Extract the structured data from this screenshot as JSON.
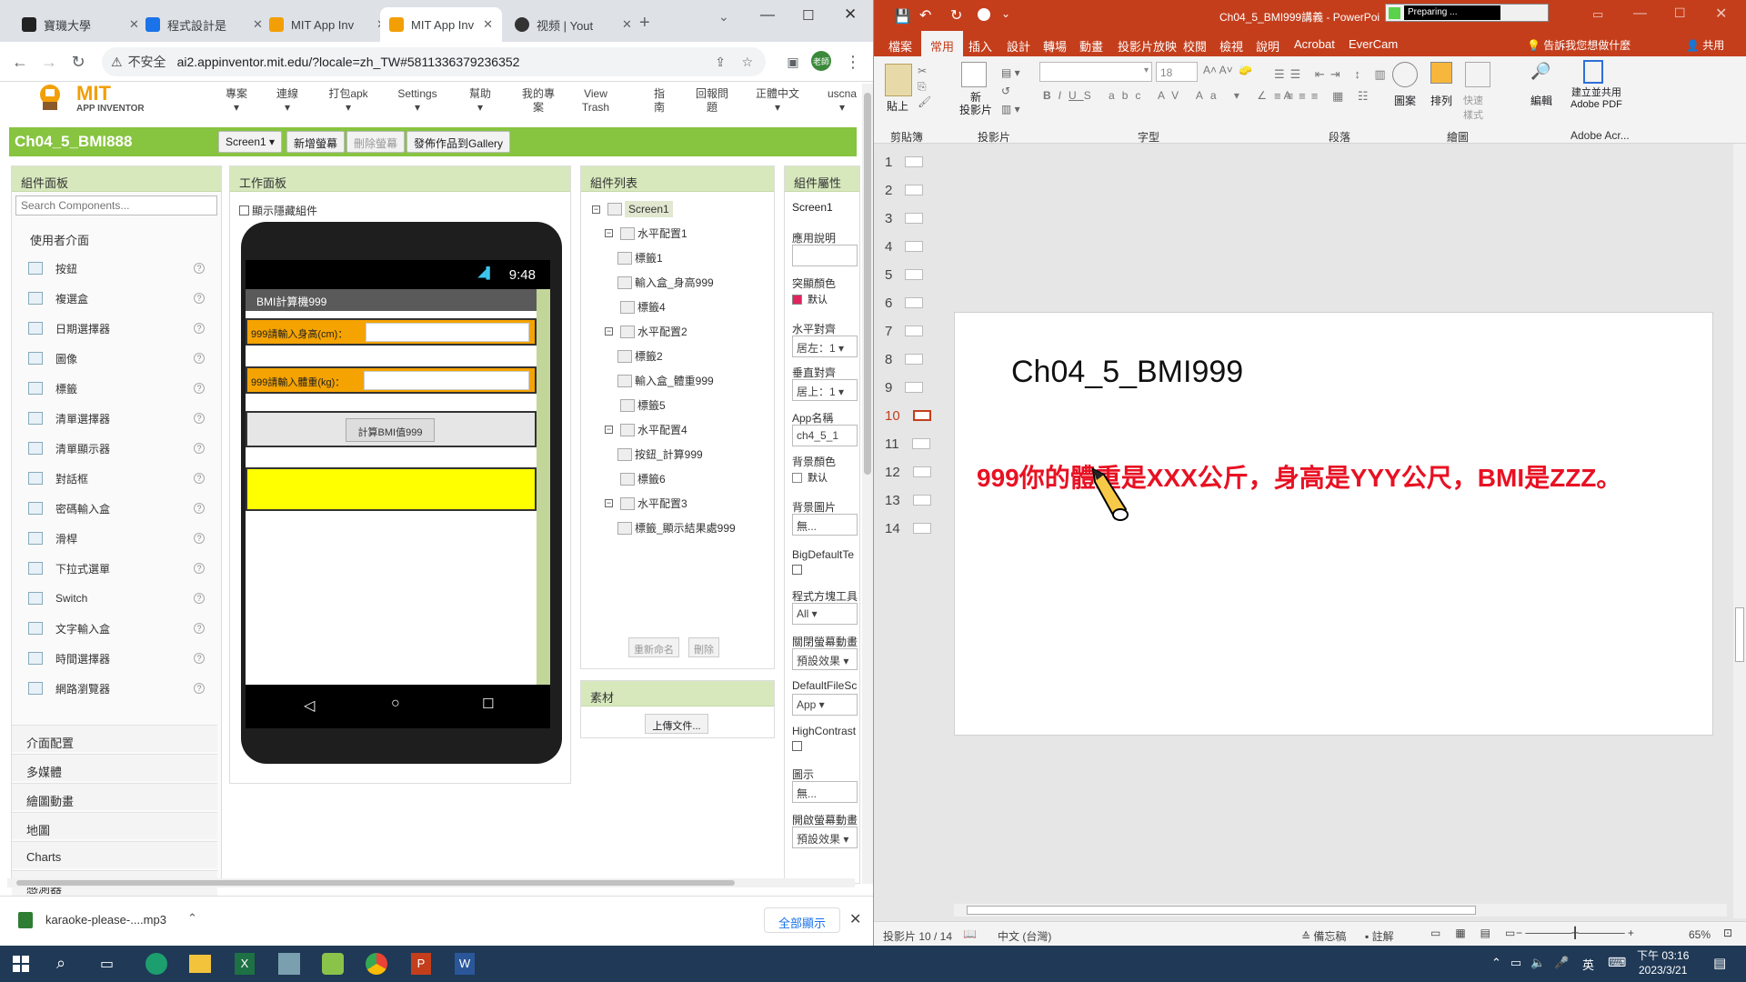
{
  "browser": {
    "tabs": [
      {
        "label": "寶璣大學",
        "icon": "github-icon",
        "color": "#222"
      },
      {
        "label": "程式設計是",
        "icon": "pen-icon",
        "color": "#1a73e8"
      },
      {
        "label": "MIT App Inv",
        "icon": "ai-icon",
        "color": "#f29f05"
      },
      {
        "label": "MIT App Inv",
        "icon": "ai-icon",
        "color": "#f29f05"
      },
      {
        "label": "视频 | Yout",
        "icon": "video-icon",
        "color": "#333"
      }
    ],
    "security": "不安全",
    "url": "ai2.appinventor.mit.edu/?locale=zh_TW#5811336379236352",
    "profile": "老師"
  },
  "appinventor": {
    "logo_main": "MIT",
    "logo_sub": "APP INVENTOR",
    "menu": [
      "專案",
      "連線",
      "打包apk",
      "Settings",
      "幫助",
      "我的專案",
      "View Trash",
      "指南",
      "回報問題",
      "正體中文",
      "uscna"
    ],
    "project_title": "Ch04_5_BMI888",
    "project_buttons": [
      "Screen1 ▾",
      "新增螢幕",
      "刪除螢幕",
      "發佈作品到Gallery"
    ],
    "palette": {
      "header": "組件面板",
      "search_placeholder": "Search Components...",
      "category": "使用者介面",
      "items": [
        "按鈕",
        "複選盒",
        "日期選擇器",
        "圖像",
        "標籤",
        "清單選擇器",
        "清單顯示器",
        "對話框",
        "密碼輸入盒",
        "滑桿",
        "下拉式選單",
        "Switch",
        "文字輸入盒",
        "時間選擇器",
        "網路瀏覽器"
      ],
      "categories": [
        "介面配置",
        "多媒體",
        "繪圖動畫",
        "地圖",
        "Charts",
        "感測器"
      ]
    },
    "viewer": {
      "header": "工作面板",
      "show_hidden": "顯示隱藏組件",
      "status_time": "9:48",
      "app_title": "BMI計算機999",
      "height_label": "999請輸入身高(cm)：",
      "weight_label": "999請輸入體重(kg)：",
      "calc_button": "計算BMI值999"
    },
    "tree": {
      "header": "組件列表",
      "rows": [
        "Screen1",
        "水平配置1",
        "標籤1",
        "輸入盒_身高999",
        "標籤4",
        "水平配置2",
        "標籤2",
        "輸入盒_體重999",
        "標籤5",
        "水平配置4",
        "按鈕_計算999",
        "標籤6",
        "水平配置3",
        "標籤_顯示結果處999"
      ],
      "rename": "重新命名",
      "delete": "刪除"
    },
    "media": {
      "header": "素材",
      "upload": "上傳文件..."
    },
    "properties": {
      "header": "組件屬性",
      "component": "Screen1",
      "items": [
        {
          "label": "應用說明",
          "value": ""
        },
        {
          "label": "突顯顏色",
          "value": "默认"
        },
        {
          "label": "水平對齊",
          "value": "居左：1 ▾"
        },
        {
          "label": "垂直對齊",
          "value": "居上：1 ▾"
        },
        {
          "label": "App名稱",
          "value": "ch4_5_1"
        },
        {
          "label": "背景顏色",
          "value": "默认"
        },
        {
          "label": "背景圖片",
          "value": "無..."
        },
        {
          "label": "BigDefaultTe",
          "value": ""
        },
        {
          "label": "程式方塊工具",
          "value": "All ▾"
        },
        {
          "label": "關閉螢幕動畫",
          "value": "預設效果 ▾"
        },
        {
          "label": "DefaultFileSc",
          "value": "App ▾"
        },
        {
          "label": "HighContrast",
          "value": ""
        },
        {
          "label": "圖示",
          "value": "無..."
        },
        {
          "label": "開啟螢幕動畫",
          "value": "預設效果 ▾"
        }
      ]
    }
  },
  "downloads": {
    "file": "karaoke-please-....mp3",
    "show_all": "全部顯示"
  },
  "ppt": {
    "title": "Ch04_5_BMI999講義 - PowerPoi",
    "preparing": "Preparing ...",
    "tabs": [
      "檔案",
      "常用",
      "插入",
      "設計",
      "轉場",
      "動畫",
      "投影片放映",
      "校閱",
      "檢視",
      "說明",
      "Acrobat",
      "EverCam"
    ],
    "tell_me": "告訴我您想做什麼",
    "share": "共用",
    "font_size": "18",
    "groups": [
      "剪貼簿",
      "投影片",
      "字型",
      "段落",
      "繪圖",
      "Adobe Acr..."
    ],
    "buttons": {
      "paste": "貼上",
      "new_slide": "新\n投影片",
      "shapes": "圖案",
      "arrange": "排列",
      "quick_styles": "快速樣式",
      "edit": "編輯",
      "pdf": "建立並共用\nAdobe PDF"
    },
    "thumbs": [
      "1",
      "2",
      "3",
      "4",
      "5",
      "6",
      "7",
      "8",
      "9",
      "10",
      "11",
      "12",
      "13",
      "14"
    ],
    "slide_title": "Ch04_5_BMI999",
    "slide_text": "999你的體重是XXX公斤，身高是YYY公尺，BMI是ZZZ。",
    "status": {
      "slide": "投影片 10 / 14",
      "lang": "中文 (台灣)",
      "notes": "備忘稿",
      "comments": "註解",
      "zoom": "65%"
    }
  },
  "taskbar": {
    "time": "下午 03:16",
    "date": "2023/3/21",
    "ime": "英"
  },
  "colors": {
    "ai_green": "#87c440",
    "ppt_red": "#c43e1c",
    "slide_red": "#e81123",
    "phone_yellow": "#ffff00",
    "label_orange": "#f5a300"
  }
}
